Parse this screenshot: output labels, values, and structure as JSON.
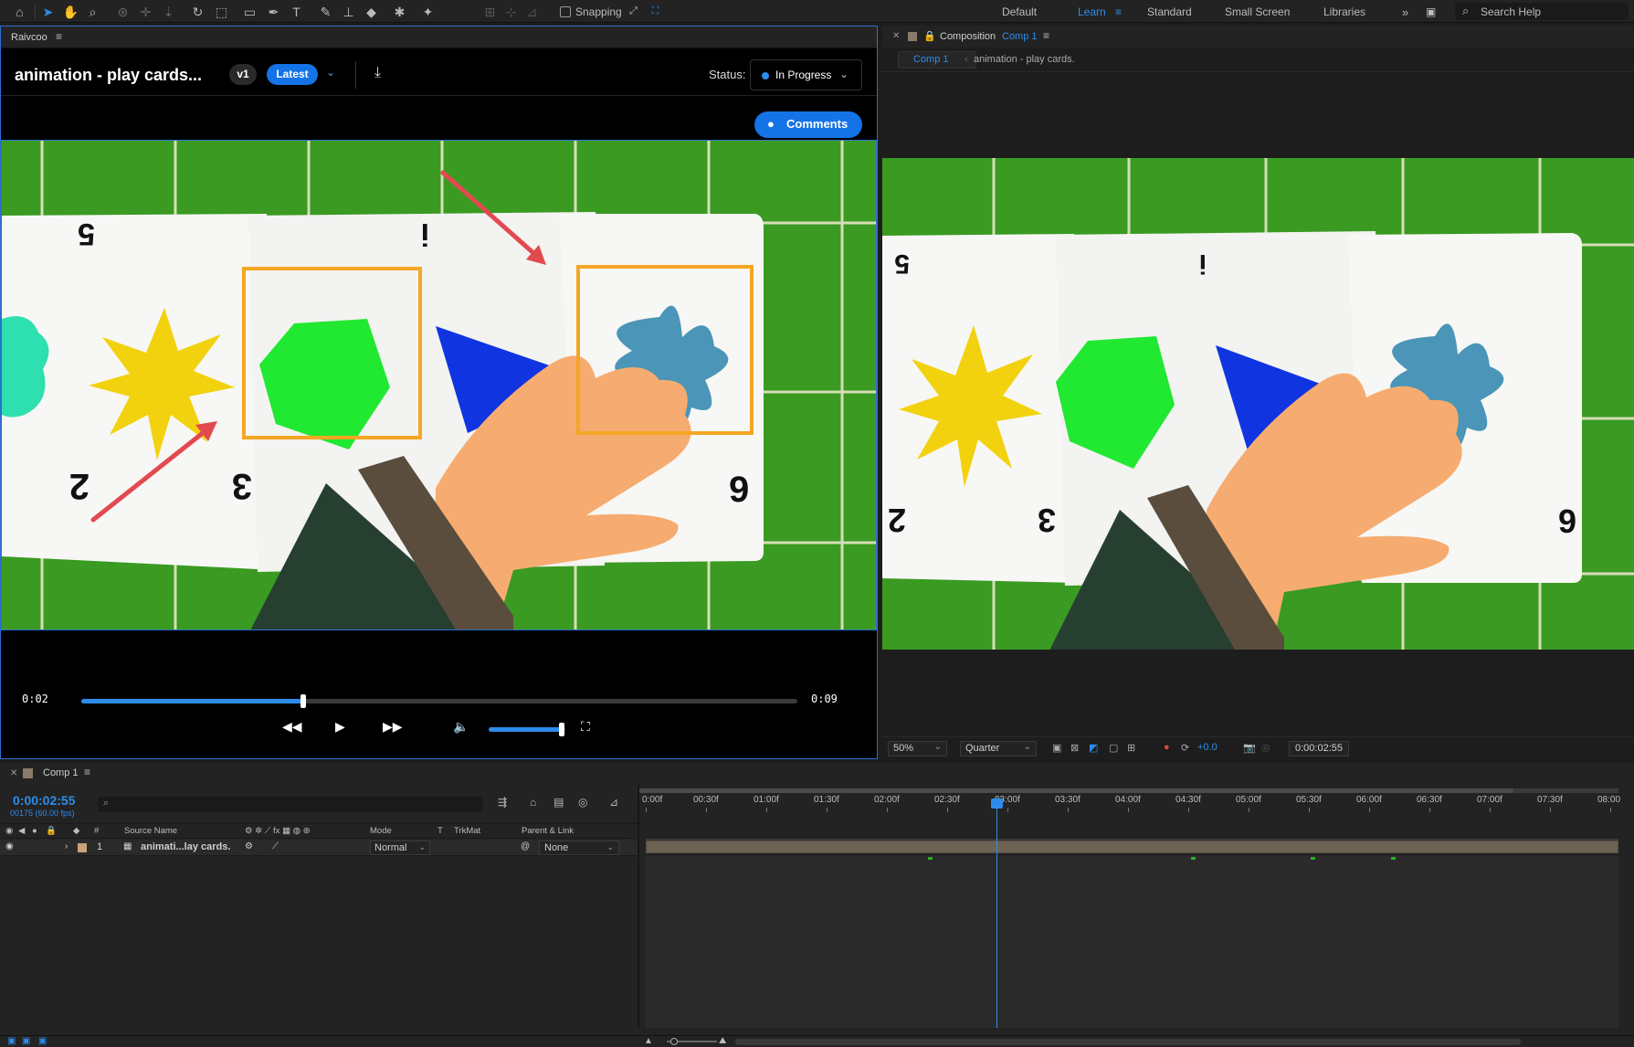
{
  "toolbar": {
    "snapping_label": "Snapping",
    "workspaces": [
      "Default",
      "Learn",
      "Standard",
      "Small Screen",
      "Libraries"
    ],
    "active_workspace": "Learn",
    "search_placeholder": "Search Help"
  },
  "plugin": {
    "panel_name": "Raivcoo",
    "title": "animation - play cards...",
    "version": "v1",
    "latest_label": "Latest",
    "status_label": "Status:",
    "status_value": "In Progress",
    "comments_label": "Comments",
    "time_current": "0:02",
    "time_duration": "0:09",
    "progress": 0.31,
    "volume": 0.95
  },
  "card_numbers": [
    "5",
    "i",
    "2",
    "3",
    "9"
  ],
  "composition": {
    "tab_label": "Composition",
    "tab_comp": "Comp 1",
    "crumb_active": "Comp 1",
    "crumb_item": "animation - play cards.",
    "zoom": "50%",
    "resolution": "Quarter",
    "exposure": "+0.0",
    "timecode": "0:00:02:55"
  },
  "timeline": {
    "tab_label": "Comp 1",
    "current_time": "0:00:02:55",
    "frame_info": "00175 (60.00 fps)",
    "headers": {
      "num": "#",
      "source_name": "Source Name",
      "mode": "Mode",
      "t": "T",
      "trkmat": "TrkMat",
      "parent": "Parent & Link"
    },
    "layer": {
      "index": "1",
      "name": "animati...lay cards.",
      "mode": "Normal",
      "parent": "None"
    },
    "ruler": [
      "0:00f",
      "00:30f",
      "01:00f",
      "01:30f",
      "02:00f",
      "02:30f",
      "03:00f",
      "03:30f",
      "04:00f",
      "04:30f",
      "05:00f",
      "05:30f",
      "06:00f",
      "06:30f",
      "07:00f",
      "07:30f",
      "08:00"
    ]
  },
  "colors": {
    "accent": "#2d8ceb",
    "button_blue": "#1473e6",
    "felt_green": "#3a9a22",
    "card_white": "#f7f7f5",
    "annotation_orange": "#f5a623",
    "annotation_red": "#e24a50"
  }
}
